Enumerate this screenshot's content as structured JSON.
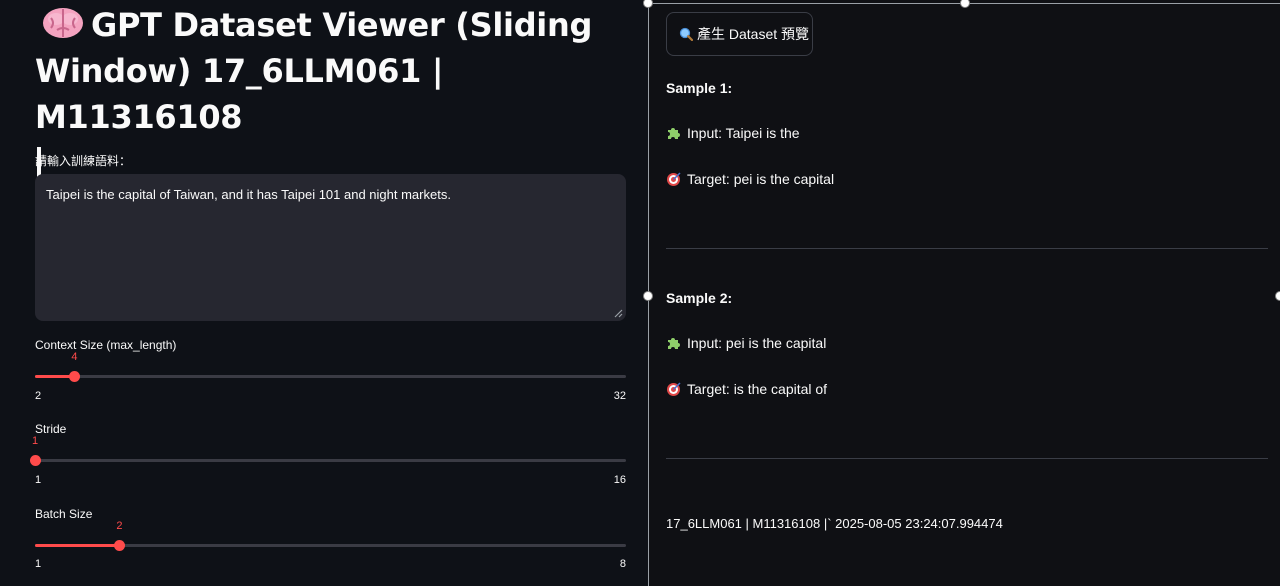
{
  "title": {
    "emoji": "brain-icon",
    "text": "GPT Dataset Viewer (Sliding Window) 17_6LLM061 | M11316108"
  },
  "corpus": {
    "label": "請輸入訓練語料：",
    "value": "Taipei is the capital of Taiwan, and it has Taipei 101 and night markets."
  },
  "sliders": {
    "context": {
      "label": "Context Size (max_length)",
      "value": 4,
      "min": "2",
      "max": "32",
      "value_label": "4"
    },
    "stride": {
      "label": "Stride",
      "value": 1,
      "min": "1",
      "max": "16",
      "value_label": "1"
    },
    "batch": {
      "label": "Batch Size",
      "value": 2,
      "min": "1",
      "max": "8",
      "value_label": "2"
    }
  },
  "preview_button": {
    "label": "產生 Dataset 預覽",
    "icon": "magnifier-icon"
  },
  "samples": [
    {
      "heading": "Sample 1:",
      "input": "Input: Taipei is the",
      "target": "Target: pei is the capital"
    },
    {
      "heading": "Sample 2:",
      "input": "Input: pei is the capital",
      "target": "Target: is the capital of"
    }
  ],
  "footer": "17_6LLM061 | M11316108 |` 2025-08-05 23:24:07.994474",
  "colors": {
    "accent": "#ff4b4b",
    "bg": "#0e1117",
    "input_bg": "#262730"
  }
}
